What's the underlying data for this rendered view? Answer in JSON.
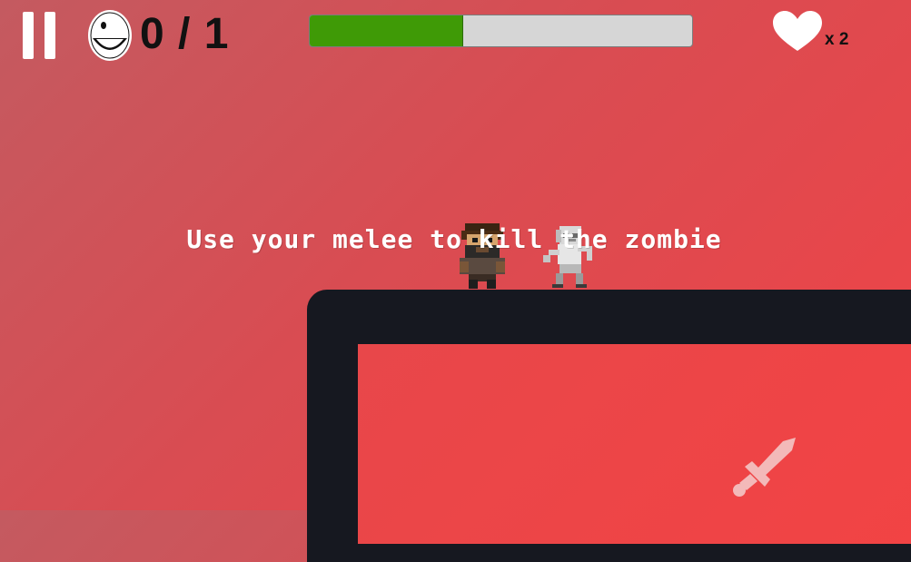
{
  "hud": {
    "pause_icon": "pause-icon",
    "kill_icon": "smiley-face-icon",
    "kills_text": "0 / 1",
    "progress_fraction": 0.4,
    "progress_fill_color": "#3f9a06",
    "heart_icon": "heart-icon",
    "lives_text": "x 2"
  },
  "tutorial": {
    "message": "Use your melee to kill the zombie"
  },
  "characters": {
    "player_icon": "bearded-hero-sprite",
    "enemy_icon": "zombie-sprite"
  },
  "controls": {
    "melee_icon": "sword-icon"
  },
  "colors": {
    "background": "#d94c52",
    "platform": "#161820",
    "text": "#111111"
  }
}
